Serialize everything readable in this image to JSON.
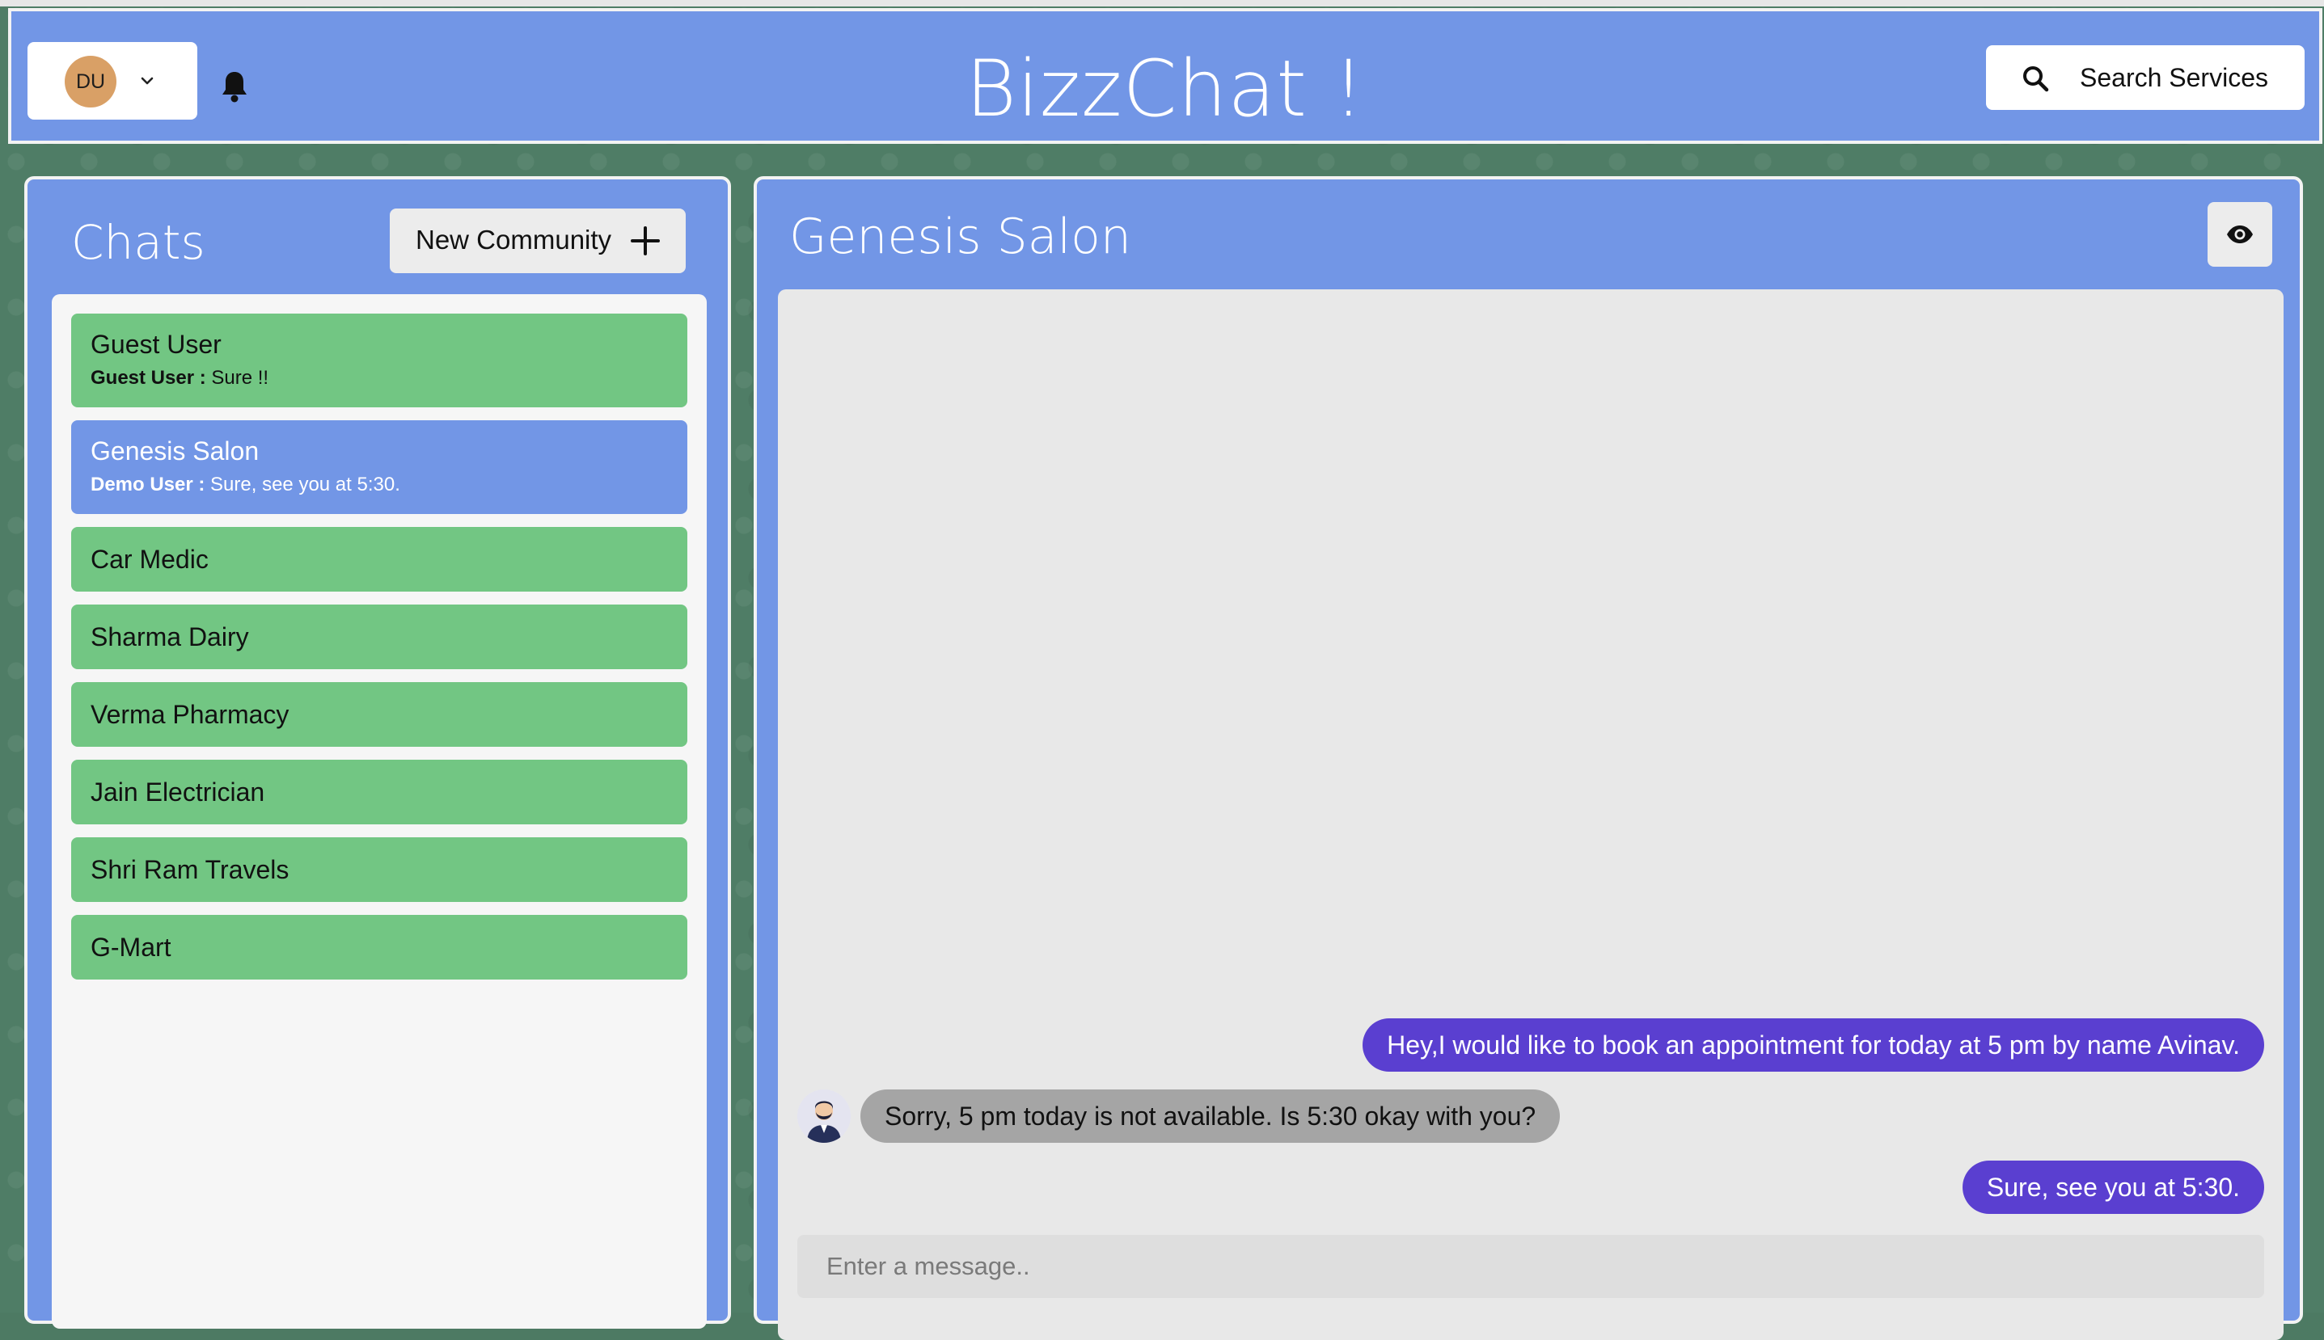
{
  "header": {
    "avatar_initials": "DU",
    "title": "BizzChat !",
    "search_label": "Search Services"
  },
  "chats": {
    "title": "Chats",
    "new_community_label": "New Community",
    "items": [
      {
        "name": "Guest User",
        "preview_sender": "Guest User :",
        "preview_text": " Sure !!",
        "active": false
      },
      {
        "name": "Genesis Salon",
        "preview_sender": "Demo User :",
        "preview_text": " Sure, see you at 5:30.",
        "active": true
      },
      {
        "name": "Car Medic",
        "active": false
      },
      {
        "name": "Sharma Dairy",
        "active": false
      },
      {
        "name": "Verma Pharmacy",
        "active": false
      },
      {
        "name": "Jain Electrician",
        "active": false
      },
      {
        "name": "Shri Ram Travels",
        "active": false
      },
      {
        "name": "G-Mart",
        "active": false
      }
    ]
  },
  "conversation": {
    "title": "Genesis Salon",
    "messages": [
      {
        "direction": "out",
        "text": "Hey,I would like to book an appointment for today at 5 pm by name Avinav."
      },
      {
        "direction": "in",
        "text": "Sorry, 5 pm today is not available. Is 5:30 okay with you?"
      },
      {
        "direction": "out",
        "text": "Sure, see you at 5:30."
      }
    ],
    "input_placeholder": "Enter a message.."
  },
  "colors": {
    "header_bg": "#7296e6",
    "chat_item_bg": "#72c683",
    "outgoing_bubble": "#5a3fd0",
    "incoming_bubble": "#a5a5a5"
  },
  "icons": [
    "chevron-down-icon",
    "bell-icon",
    "search-icon",
    "plus-icon",
    "eye-icon"
  ]
}
